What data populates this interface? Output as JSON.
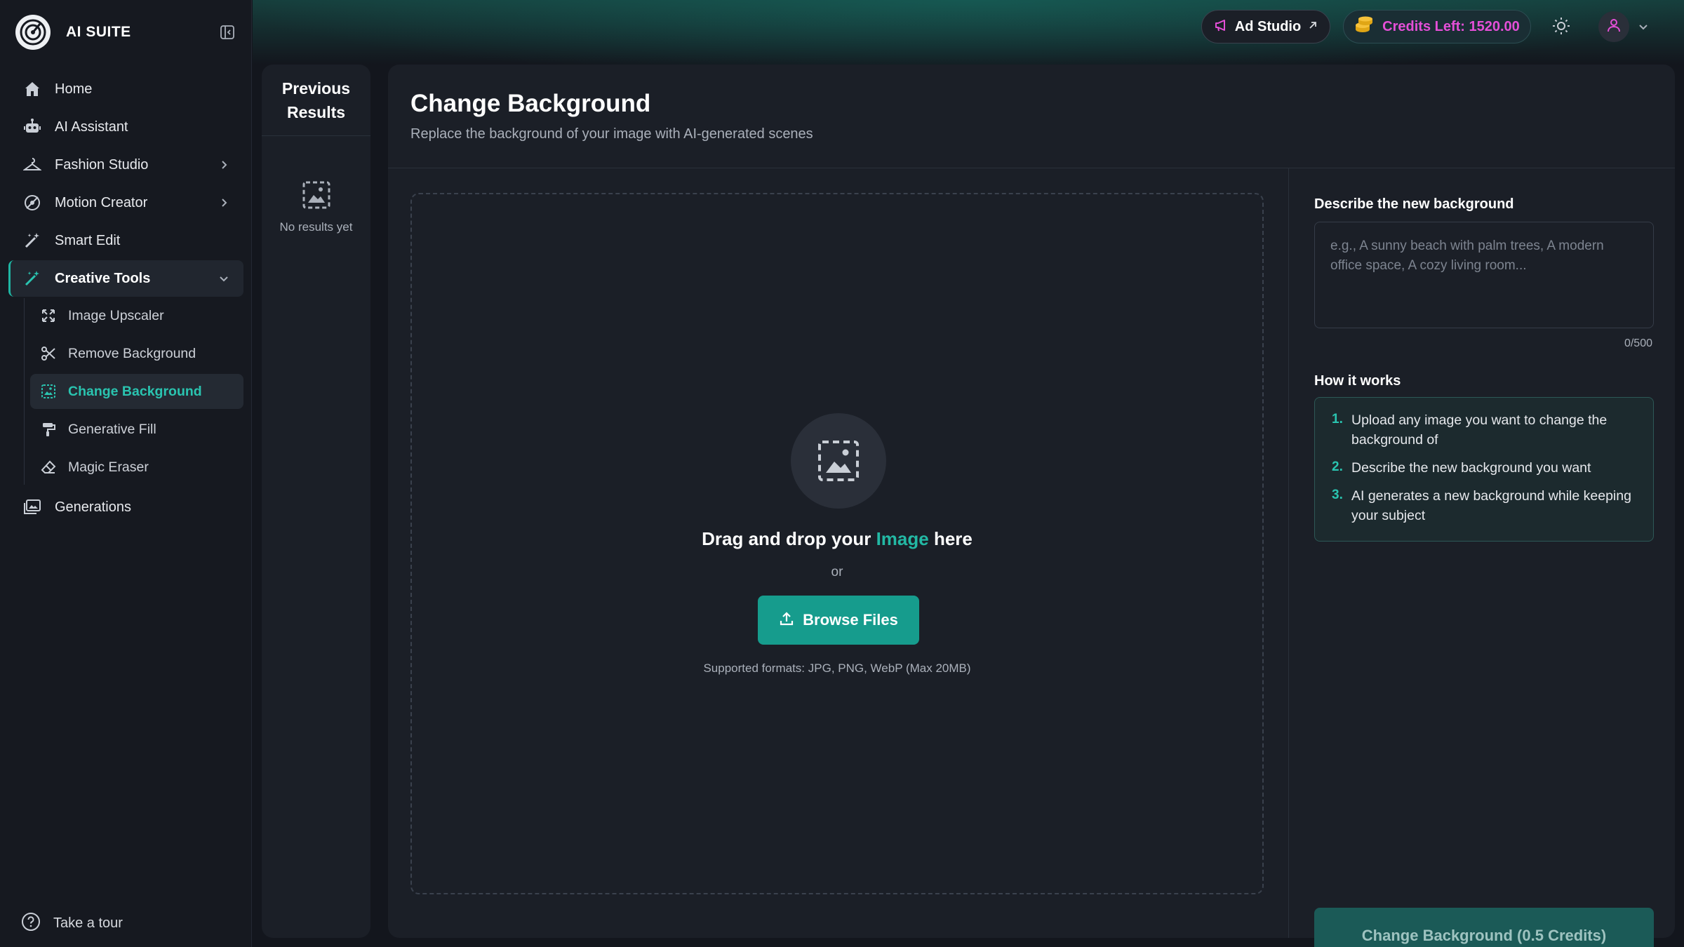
{
  "brand": {
    "name": "AI SUITE"
  },
  "sidebar": {
    "items": [
      {
        "label": "Home"
      },
      {
        "label": "AI Assistant"
      },
      {
        "label": "Fashion Studio"
      },
      {
        "label": "Motion Creator"
      },
      {
        "label": "Smart Edit"
      },
      {
        "label": "Creative Tools"
      },
      {
        "label": "Generations"
      }
    ],
    "sub_items": [
      {
        "label": "Image Upscaler"
      },
      {
        "label": "Remove Background"
      },
      {
        "label": "Change Background"
      },
      {
        "label": "Generative Fill"
      },
      {
        "label": "Magic Eraser"
      }
    ],
    "tour_label": "Take a tour"
  },
  "header": {
    "ad_studio_label": "Ad Studio",
    "credits_label": "Credits Left: 1520.00"
  },
  "previous": {
    "title": "Previous Results",
    "empty_text": "No results yet"
  },
  "main": {
    "title": "Change Background",
    "subtitle": "Replace the background of your image with AI-generated scenes",
    "dropzone": {
      "title_before": "Drag and drop your ",
      "title_highlight": "Image",
      "title_after": " here",
      "or_text": "or",
      "browse_label": "Browse Files",
      "formats": "Supported formats: JPG, PNG, WebP (Max 20MB)"
    },
    "describe": {
      "label": "Describe the new background",
      "placeholder": "e.g., A sunny beach with palm trees, A modern office space, A cozy living room...",
      "value": "",
      "count": "0/500"
    },
    "how": {
      "label": "How it works",
      "steps": [
        {
          "num": "1.",
          "text": "Upload any image you want to change the background of"
        },
        {
          "num": "2.",
          "text": "Describe the new background you want"
        },
        {
          "num": "3.",
          "text": "AI generates a new background while keeping your subject"
        }
      ]
    },
    "cta_label": "Change Background (0.5 Credits)"
  },
  "colors": {
    "accent": "#1fb5a3",
    "credits": "#e44fd7",
    "background": "#13161d",
    "panel": "#1b1f27"
  }
}
